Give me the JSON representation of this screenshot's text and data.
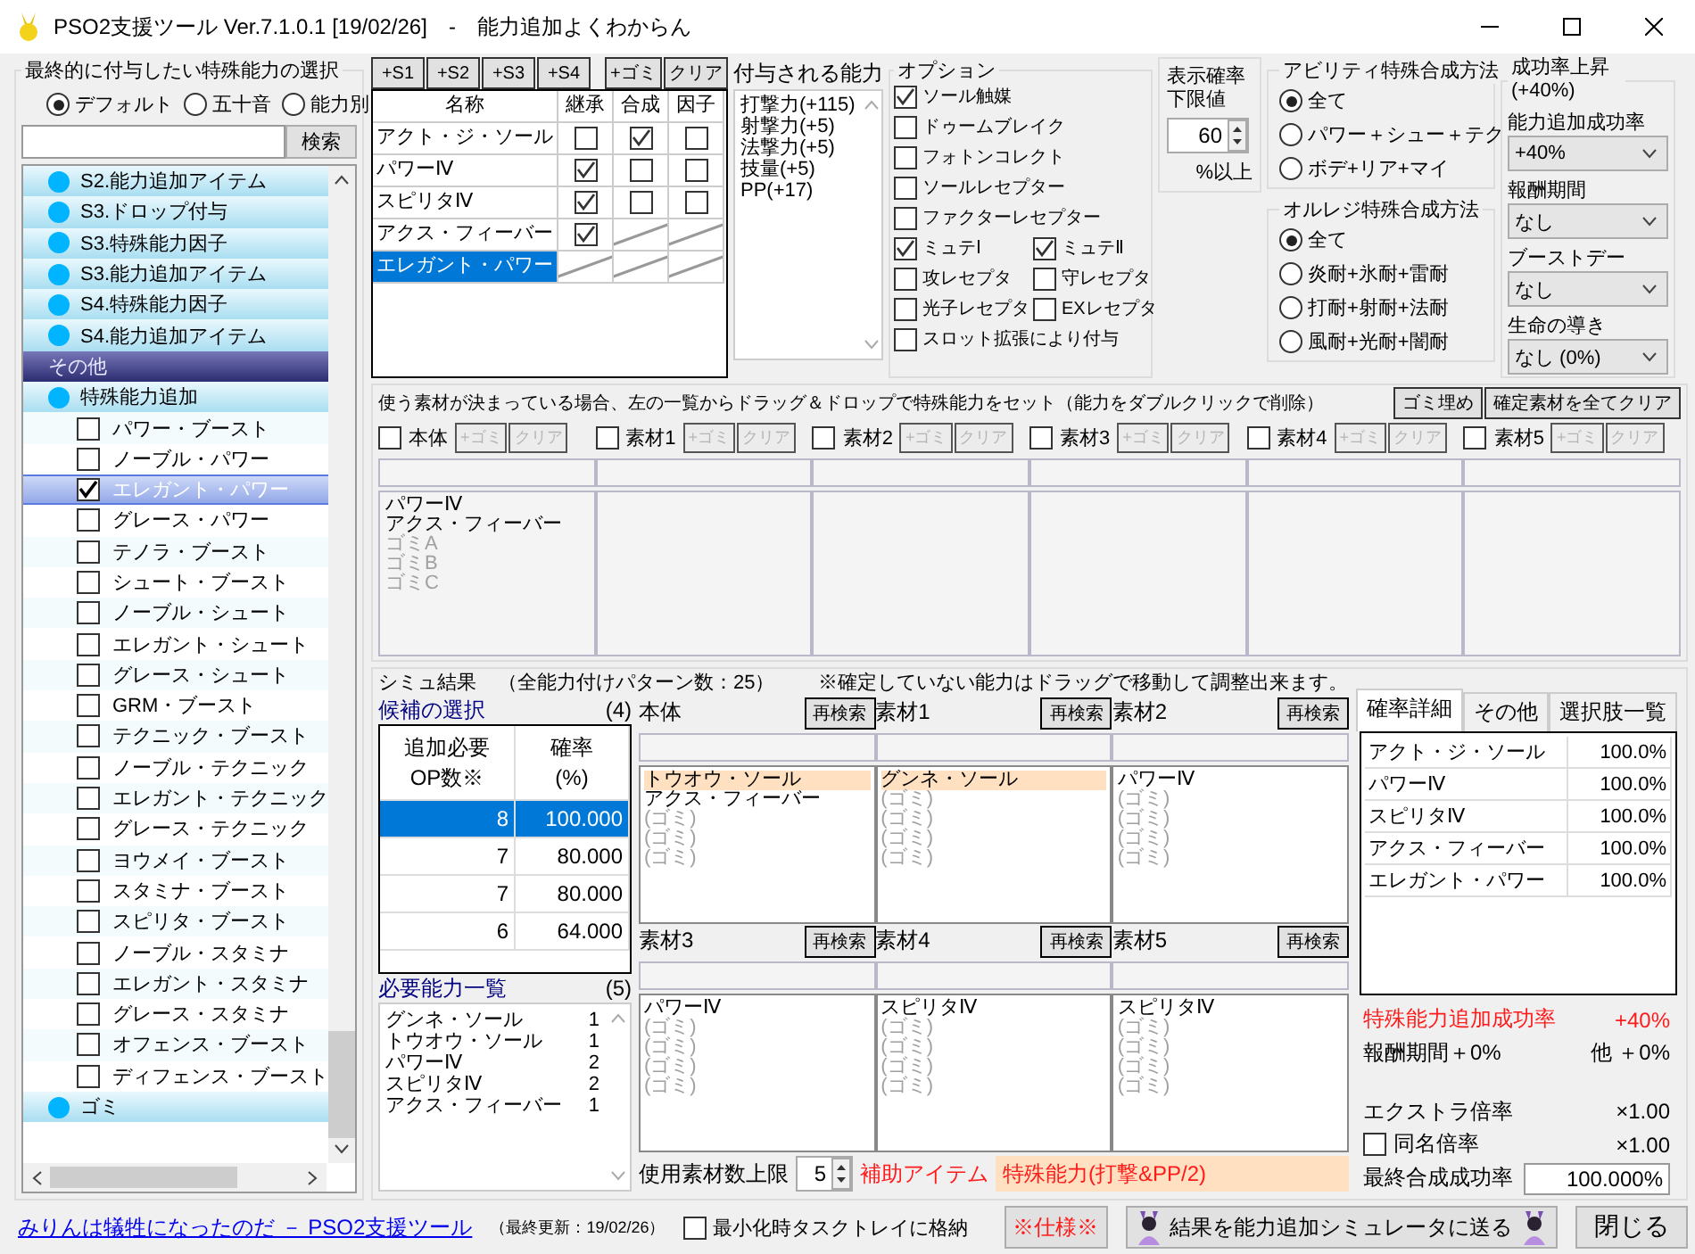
{
  "window": {
    "title": "PSO2支援ツール Ver.7.1.0.1 [19/02/26]　-　能力追加よくわからん"
  },
  "selector": {
    "title": "最終的に付与したい特殊能力の選択",
    "sort_options": [
      {
        "label": "デフォルト",
        "selected": true
      },
      {
        "label": "五十音",
        "selected": false
      },
      {
        "label": "能力別",
        "selected": false
      }
    ],
    "search_button": "検索",
    "items": [
      {
        "kind": "group",
        "label": "S2.能力追加アイテム",
        "selected": false
      },
      {
        "kind": "group",
        "label": "S3.ドロップ付与",
        "selected": false
      },
      {
        "kind": "group",
        "label": "S3.特殊能力因子",
        "selected": false
      },
      {
        "kind": "group",
        "label": "S3.能力追加アイテム",
        "selected": false
      },
      {
        "kind": "group",
        "label": "S4.特殊能力因子",
        "selected": false
      },
      {
        "kind": "group",
        "label": "S4.能力追加アイテム",
        "selected": false
      },
      {
        "kind": "section",
        "label": "その他",
        "selected": false
      },
      {
        "kind": "group",
        "label": "特殊能力追加",
        "selected": false
      },
      {
        "kind": "ability",
        "label": "パワー・ブースト",
        "checked": false,
        "selected": false
      },
      {
        "kind": "ability",
        "label": "ノーブル・パワー",
        "checked": false,
        "selected": false
      },
      {
        "kind": "ability",
        "label": "エレガント・パワー",
        "checked": true,
        "selected": true
      },
      {
        "kind": "ability",
        "label": "グレース・パワー",
        "checked": false,
        "selected": false
      },
      {
        "kind": "ability",
        "label": "テノラ・ブースト",
        "checked": false,
        "selected": false
      },
      {
        "kind": "ability",
        "label": "シュート・ブースト",
        "checked": false,
        "selected": false
      },
      {
        "kind": "ability",
        "label": "ノーブル・シュート",
        "checked": false,
        "selected": false
      },
      {
        "kind": "ability",
        "label": "エレガント・シュート",
        "checked": false,
        "selected": false
      },
      {
        "kind": "ability",
        "label": "グレース・シュート",
        "checked": false,
        "selected": false
      },
      {
        "kind": "ability",
        "label": "GRM・ブースト",
        "checked": false,
        "selected": false
      },
      {
        "kind": "ability",
        "label": "テクニック・ブースト",
        "checked": false,
        "selected": false
      },
      {
        "kind": "ability",
        "label": "ノーブル・テクニック",
        "checked": false,
        "selected": false
      },
      {
        "kind": "ability",
        "label": "エレガント・テクニック",
        "checked": false,
        "selected": false
      },
      {
        "kind": "ability",
        "label": "グレース・テクニック",
        "checked": false,
        "selected": false
      },
      {
        "kind": "ability",
        "label": "ヨウメイ・ブースト",
        "checked": false,
        "selected": false
      },
      {
        "kind": "ability",
        "label": "スタミナ・ブースト",
        "checked": false,
        "selected": false
      },
      {
        "kind": "ability",
        "label": "スピリタ・ブースト",
        "checked": false,
        "selected": false
      },
      {
        "kind": "ability",
        "label": "ノーブル・スタミナ",
        "checked": false,
        "selected": false
      },
      {
        "kind": "ability",
        "label": "エレガント・スタミナ",
        "checked": false,
        "selected": false
      },
      {
        "kind": "ability",
        "label": "グレース・スタミナ",
        "checked": false,
        "selected": false
      },
      {
        "kind": "ability",
        "label": "オフェンス・ブースト",
        "checked": false,
        "selected": false
      },
      {
        "kind": "ability",
        "label": "ディフェンス・ブースト",
        "checked": false,
        "selected": false
      },
      {
        "kind": "group",
        "label": "ゴミ",
        "selected": false
      }
    ]
  },
  "ability_table": {
    "slot_buttons": [
      "+S1",
      "+S2",
      "+S3",
      "+S4"
    ],
    "side_buttons": [
      "+ゴミ",
      "クリア"
    ],
    "columns": [
      "名称",
      "継承",
      "合成",
      "因子"
    ],
    "rows": [
      {
        "name": "アクト・ジ・ソール",
        "selected": false,
        "cells": [
          {
            "kind": "box",
            "checked": false
          },
          {
            "kind": "box",
            "checked": true
          },
          {
            "kind": "box",
            "checked": false
          }
        ]
      },
      {
        "name": "パワーⅣ",
        "selected": false,
        "cells": [
          {
            "kind": "box",
            "checked": true
          },
          {
            "kind": "box",
            "checked": false
          },
          {
            "kind": "box",
            "checked": false
          }
        ]
      },
      {
        "name": "スピリタⅣ",
        "selected": false,
        "cells": [
          {
            "kind": "box",
            "checked": true
          },
          {
            "kind": "box",
            "checked": false
          },
          {
            "kind": "box",
            "checked": false
          }
        ]
      },
      {
        "name": "アクス・フィーバー",
        "selected": false,
        "cells": [
          {
            "kind": "box",
            "checked": true
          },
          {
            "kind": "none"
          },
          {
            "kind": "none"
          }
        ]
      },
      {
        "name": "エレガント・パワー",
        "selected": true,
        "cells": [
          {
            "kind": "none"
          },
          {
            "kind": "none"
          },
          {
            "kind": "none"
          }
        ]
      }
    ]
  },
  "granted": {
    "title": "付与される能力",
    "lines": [
      "打撃力(+115)",
      "射撃力(+5)",
      "法撃力(+5)",
      "技量(+5)",
      "PP(+17)"
    ]
  },
  "options": {
    "title": "オプション",
    "items": [
      {
        "label": "ソール触媒",
        "checked": true,
        "kind": "full"
      },
      {
        "label": "ドゥームブレイク",
        "checked": false,
        "kind": "full"
      },
      {
        "label": "フォトンコレクト",
        "checked": false,
        "kind": "full"
      },
      {
        "label": "ソールレセプター",
        "checked": false,
        "kind": "full"
      },
      {
        "label": "ファクターレセプター",
        "checked": false,
        "kind": "full"
      },
      {
        "label": "ミュテⅠ",
        "checked": true,
        "kind": "half"
      },
      {
        "label": "ミュテⅡ",
        "checked": true,
        "kind": "half"
      },
      {
        "label": "攻レセプタ",
        "checked": false,
        "kind": "half"
      },
      {
        "label": "守レセプタ",
        "checked": false,
        "kind": "half"
      },
      {
        "label": "光子レセプタ",
        "checked": false,
        "kind": "half"
      },
      {
        "label": "EXレセプタ",
        "checked": false,
        "kind": "half"
      },
      {
        "label": "スロット拡張により付与",
        "checked": false,
        "kind": "full"
      }
    ]
  },
  "threshold": {
    "title": "表示確率下限値",
    "value": "60",
    "unit": "%以上"
  },
  "ability_method": {
    "title": "アビリティ特殊合成方法",
    "options": [
      {
        "label": "全て",
        "selected": true
      },
      {
        "label": "パワー＋シュー＋テク",
        "selected": false
      },
      {
        "label": "ボデ+リア+マイ",
        "selected": false
      }
    ]
  },
  "resist_method": {
    "title": "オルレジ特殊合成方法",
    "options": [
      {
        "label": "全て",
        "selected": true
      },
      {
        "label": "炎耐+氷耐+雷耐",
        "selected": false
      },
      {
        "label": "打耐+射耐+法耐",
        "selected": false
      },
      {
        "label": "風耐+光耐+闇耐",
        "selected": false
      }
    ]
  },
  "boost": {
    "title": "成功率上昇 (+40%)",
    "fields": [
      {
        "label": "能力追加成功率",
        "value": "+40%"
      },
      {
        "label": "報酬期間",
        "value": "なし"
      },
      {
        "label": "ブーストデー",
        "value": "なし"
      },
      {
        "label": "生命の導き",
        "value": "なし (0%)"
      }
    ]
  },
  "materials": {
    "hint": "使う素材が決まっている場合、左の一覧からドラッグ＆ドロップで特殊能力をセット（能力をダブルクリックで削除）",
    "buttons": [
      "ゴミ埋め",
      "確定素材を全てクリア"
    ],
    "slots": [
      {
        "label": "本体",
        "checked": false,
        "add_button": "+ゴミ",
        "clear_button": "クリア",
        "disabled": true,
        "lines": [
          {
            "text": "パワーⅣ",
            "kind": "set"
          },
          {
            "text": "アクス・フィーバー",
            "kind": "set"
          },
          {
            "text": "ゴミA",
            "kind": "filler"
          },
          {
            "text": "ゴミB",
            "kind": "filler"
          },
          {
            "text": "ゴミC",
            "kind": "filler"
          }
        ]
      },
      {
        "label": "素材1",
        "checked": false,
        "add_button": "+ゴミ",
        "clear_button": "クリア",
        "disabled": true
      },
      {
        "label": "素材2",
        "checked": false,
        "add_button": "+ゴミ",
        "clear_button": "クリア",
        "disabled": true
      },
      {
        "label": "素材3",
        "checked": false,
        "add_button": "+ゴミ",
        "clear_button": "クリア",
        "disabled": true
      },
      {
        "label": "素材4",
        "checked": false,
        "add_button": "+ゴミ",
        "clear_button": "クリア",
        "disabled": true
      },
      {
        "label": "素材5",
        "checked": false,
        "add_button": "+ゴミ",
        "clear_button": "クリア",
        "disabled": true
      }
    ]
  },
  "results": {
    "title": "シミュ結果",
    "pattern_count": "（全能力付けパターン数：25）",
    "note": "※確定していない能力はドラッグで移動して調整出来ます。",
    "candidates": {
      "title": "候補の選択",
      "count": "(4)",
      "columns": [
        {
          "lines": [
            "追加必要",
            "OP数※"
          ]
        },
        {
          "lines": [
            "確率",
            "(%)"
          ]
        }
      ],
      "rows": [
        {
          "op": "8",
          "rate": "100.000",
          "selected": true
        },
        {
          "op": "7",
          "rate": "80.000",
          "selected": false
        },
        {
          "op": "7",
          "rate": "80.000",
          "selected": false
        },
        {
          "op": "6",
          "rate": "64.000",
          "selected": false
        }
      ]
    },
    "required": {
      "title": "必要能力一覧",
      "count": "(5)",
      "items": [
        {
          "name": "グンネ・ソール",
          "count": "1"
        },
        {
          "name": "トウオウ・ソール",
          "count": "1"
        },
        {
          "name": "パワーⅣ",
          "count": "2"
        },
        {
          "name": "スピリタⅣ",
          "count": "2"
        },
        {
          "name": "アクス・フィーバー",
          "count": "1"
        }
      ]
    },
    "panels": [
      {
        "title": "本体",
        "button": "再検索",
        "lines": [
          {
            "text": "トウオウ・ソール",
            "kind": "fixed"
          },
          {
            "text": "アクス・フィーバー",
            "kind": "set"
          },
          {
            "text": "(ゴミ)",
            "kind": "filler"
          },
          {
            "text": "(ゴミ)",
            "kind": "filler"
          },
          {
            "text": "(ゴミ)",
            "kind": "filler"
          }
        ]
      },
      {
        "title": "素材1",
        "button": "再検索",
        "lines": [
          {
            "text": "グンネ・ソール",
            "kind": "fixed"
          },
          {
            "text": "(ゴミ)",
            "kind": "filler"
          },
          {
            "text": "(ゴミ)",
            "kind": "filler"
          },
          {
            "text": "(ゴミ)",
            "kind": "filler"
          },
          {
            "text": "(ゴミ)",
            "kind": "filler"
          }
        ]
      },
      {
        "title": "素材2",
        "button": "再検索",
        "lines": [
          {
            "text": "パワーⅣ",
            "kind": "set"
          },
          {
            "text": "(ゴミ)",
            "kind": "filler"
          },
          {
            "text": "(ゴミ)",
            "kind": "filler"
          },
          {
            "text": "(ゴミ)",
            "kind": "filler"
          },
          {
            "text": "(ゴミ)",
            "kind": "filler"
          }
        ]
      },
      {
        "title": "素材3",
        "button": "再検索",
        "lines": [
          {
            "text": "パワーⅣ",
            "kind": "set"
          },
          {
            "text": "(ゴミ)",
            "kind": "filler"
          },
          {
            "text": "(ゴミ)",
            "kind": "filler"
          },
          {
            "text": "(ゴミ)",
            "kind": "filler"
          },
          {
            "text": "(ゴミ)",
            "kind": "filler"
          }
        ]
      },
      {
        "title": "素材4",
        "button": "再検索",
        "lines": [
          {
            "text": "スピリタⅣ",
            "kind": "set"
          },
          {
            "text": "(ゴミ)",
            "kind": "filler"
          },
          {
            "text": "(ゴミ)",
            "kind": "filler"
          },
          {
            "text": "(ゴミ)",
            "kind": "filler"
          },
          {
            "text": "(ゴミ)",
            "kind": "filler"
          }
        ]
      },
      {
        "title": "素材5",
        "button": "再検索",
        "lines": [
          {
            "text": "スピリタⅣ",
            "kind": "set"
          },
          {
            "text": "(ゴミ)",
            "kind": "filler"
          },
          {
            "text": "(ゴミ)",
            "kind": "filler"
          },
          {
            "text": "(ゴミ)",
            "kind": "filler"
          },
          {
            "text": "(ゴミ)",
            "kind": "filler"
          }
        ]
      }
    ],
    "limit_label": "使用素材数上限",
    "limit_value": "5",
    "aux_label": "補助アイテム",
    "aux_value": "特殊能力(打撃&PP/2)",
    "detail": {
      "tabs": [
        {
          "label": "確率詳細",
          "selected": true
        },
        {
          "label": "その他",
          "selected": false
        },
        {
          "label": "選択肢一覧",
          "selected": false
        }
      ],
      "rows": [
        {
          "name": "アクト・ジ・ソール",
          "rate": "100.0%"
        },
        {
          "name": "パワーⅣ",
          "rate": "100.0%"
        },
        {
          "name": "スピリタⅣ",
          "rate": "100.0%"
        },
        {
          "name": "アクス・フィーバー",
          "rate": "100.0%"
        },
        {
          "name": "エレガント・パワー",
          "rate": "100.0%"
        }
      ],
      "bonus_label": "特殊能力追加成功率",
      "bonus_value": "+40%",
      "reward": "報酬期間＋0%",
      "other": "他 ＋0%",
      "extra_label": "エクストラ倍率",
      "extra_value": "×1.00",
      "same_name": {
        "label": "同名倍率",
        "checked": false
      },
      "same_value": "×1.00",
      "final_label": "最終合成成功率",
      "final_value": "100.000%"
    }
  },
  "footer": {
    "link": "みりんは犠牲になったのだ － PSO2支援ツール",
    "updated": "（最終更新：19/02/26）",
    "tray": {
      "label": "最小化時タスクトレイに格納",
      "checked": false
    },
    "spec_button": "※仕様※",
    "send_button": "結果を能力追加シミュレータに送る",
    "close_button": "閉じる"
  }
}
